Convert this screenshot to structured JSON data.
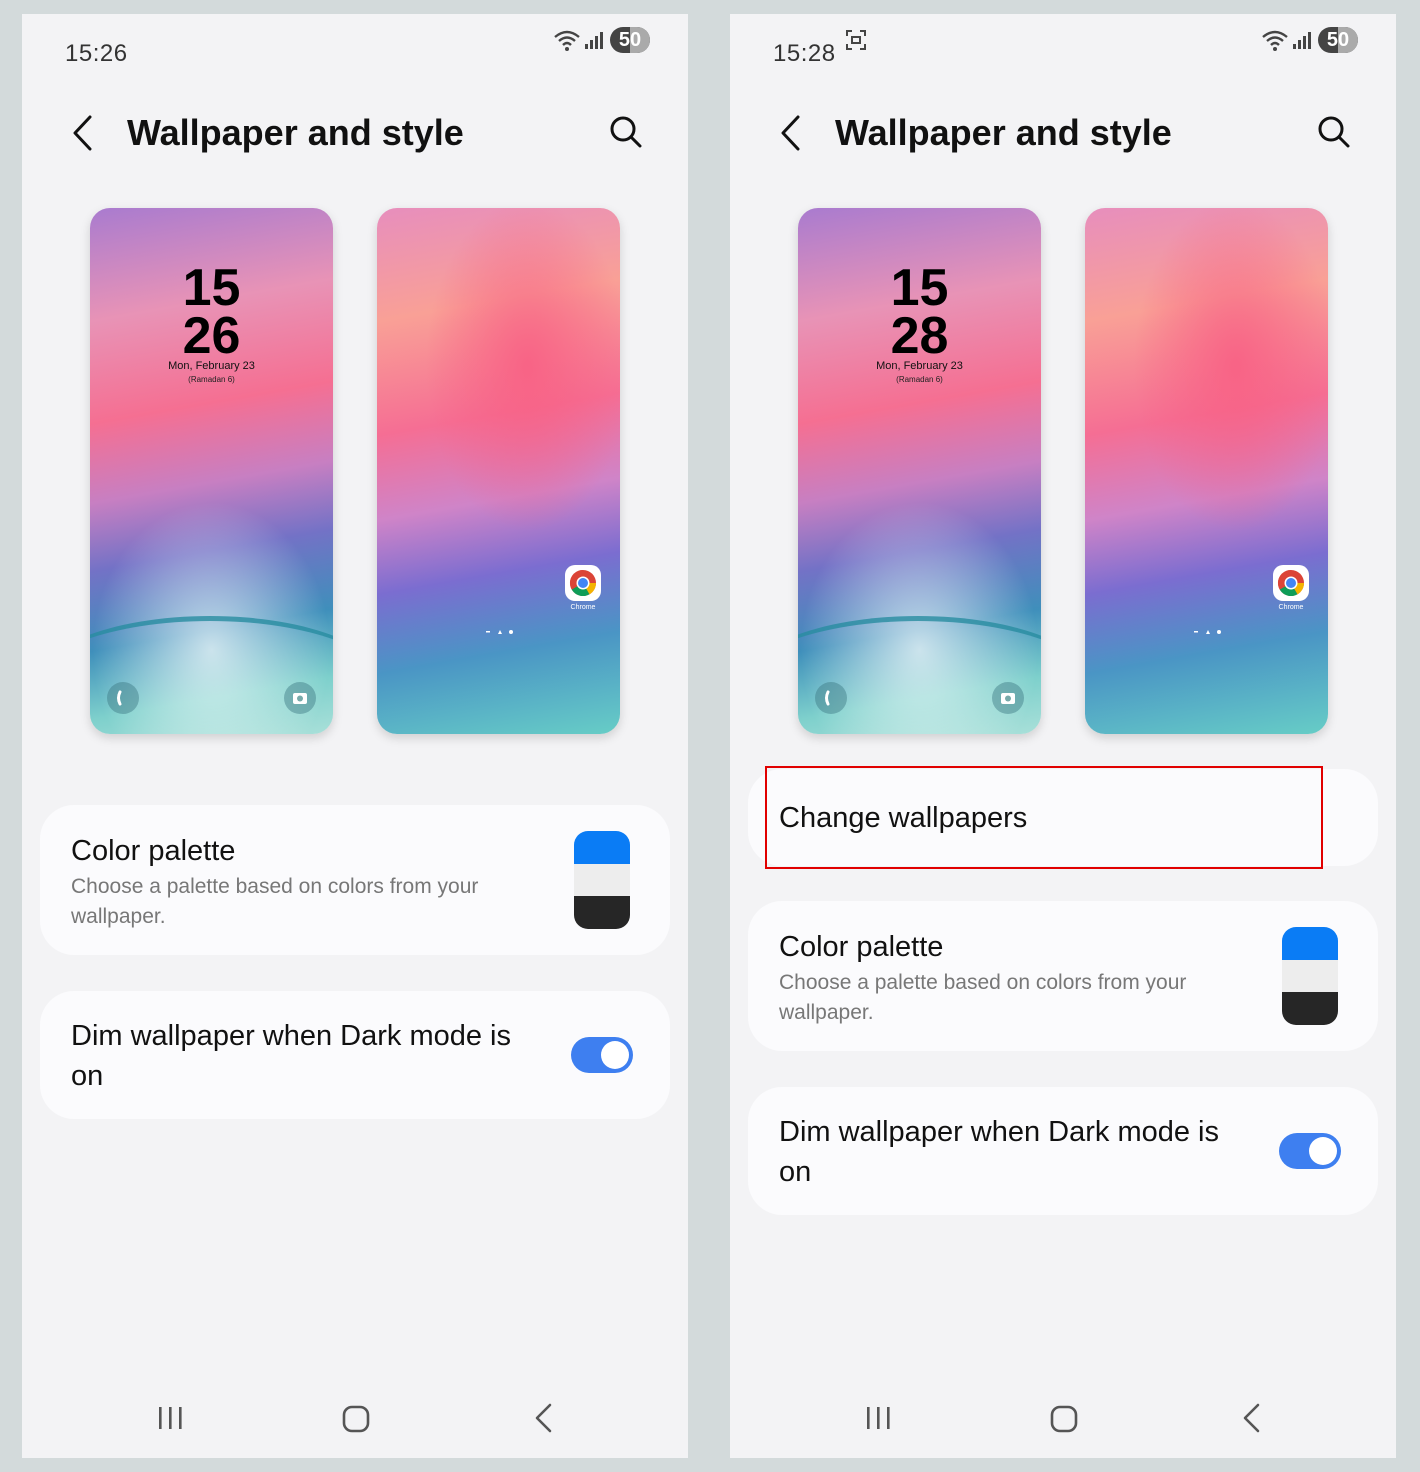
{
  "screens": [
    {
      "status": {
        "time": "15:26",
        "battery": "50"
      },
      "header": {
        "title": "Wallpaper and style"
      },
      "lock_preview": {
        "hour": "15",
        "minute": "26",
        "date": "Mon, February 23",
        "hijri": "(Ramadan 6)"
      },
      "home_preview": {
        "app_label": "Chrome"
      },
      "color_palette": {
        "title": "Color palette",
        "subtitle": "Choose a palette based on colors from your wallpaper."
      },
      "dim_wallpaper": {
        "title": "Dim wallpaper when Dark mode is on",
        "enabled": true
      }
    },
    {
      "status": {
        "time": "15:28",
        "battery": "50"
      },
      "header": {
        "title": "Wallpaper and style"
      },
      "lock_preview": {
        "hour": "15",
        "minute": "28",
        "date": "Mon, February 23",
        "hijri": "(Ramadan 6)"
      },
      "home_preview": {
        "app_label": "Chrome"
      },
      "change_wallpapers": {
        "label": "Change wallpapers"
      },
      "color_palette": {
        "title": "Color palette",
        "subtitle": "Choose a palette based on colors from your wallpaper."
      },
      "dim_wallpaper": {
        "title": "Dim wallpaper when Dark mode is on",
        "enabled": true
      }
    }
  ],
  "colors": {
    "highlight": "#e10000",
    "toggle_on": "#3e7ff0",
    "palette": [
      "#0a7cf5",
      "#ededed",
      "#262626"
    ]
  },
  "icons": [
    "back-arrow-icon",
    "search-icon",
    "wifi-icon",
    "signal-icon",
    "screenshot-icon",
    "chrome-icon",
    "phone-icon",
    "camera-icon",
    "recents-icon",
    "home-icon",
    "nav-back-icon"
  ]
}
